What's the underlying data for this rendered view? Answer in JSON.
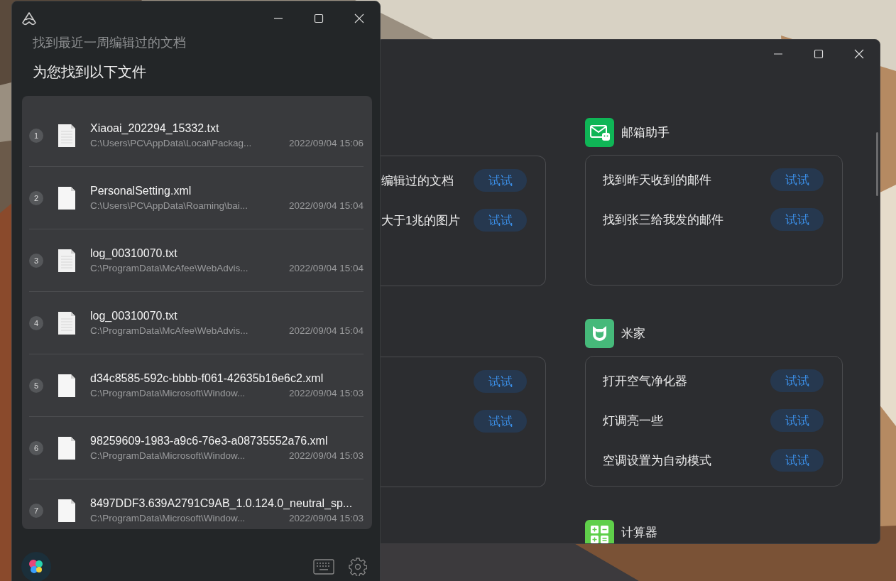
{
  "assistant_window": {
    "query": "找到最近一周编辑过的文档",
    "answer": "为您找到以下文件",
    "files": [
      {
        "number": "1",
        "kind": "text",
        "name": "Xiaoai_202294_15332.txt",
        "path": "C:\\Users\\PC\\AppData\\Local\\Packag...",
        "time": "2022/09/04 15:06"
      },
      {
        "number": "2",
        "kind": "blank",
        "name": "PersonalSetting.xml",
        "path": "C:\\Users\\PC\\AppData\\Roaming\\bai...",
        "time": "2022/09/04 15:04"
      },
      {
        "number": "3",
        "kind": "text",
        "name": "log_00310070.txt",
        "path": "C:\\ProgramData\\McAfee\\WebAdvis...",
        "time": "2022/09/04 15:04"
      },
      {
        "number": "4",
        "kind": "text",
        "name": "log_00310070.txt",
        "path": "C:\\ProgramData\\McAfee\\WebAdvis...",
        "time": "2022/09/04 15:04"
      },
      {
        "number": "5",
        "kind": "blank",
        "name": "d34c8585-592c-bbbb-f061-42635b16e6c2.xml",
        "path": "C:\\ProgramData\\Microsoft\\Window...",
        "time": "2022/09/04 15:03"
      },
      {
        "number": "6",
        "kind": "blank",
        "name": "98259609-1983-a9c6-76e3-a08735552a76.xml",
        "path": "C:\\ProgramData\\Microsoft\\Window...",
        "time": "2022/09/04 15:03"
      },
      {
        "number": "7",
        "kind": "blank",
        "name": "8497DDF3.639A2791C9AB_1.0.124.0_neutral_sp...",
        "path": "C:\\ProgramData\\Microsoft\\Window...",
        "time": "2022/09/04 15:03"
      }
    ]
  },
  "skills_window": {
    "left_cards": [
      {
        "items": [
          {
            "text": "编辑过的文档",
            "button": "试试"
          },
          {
            "text": "大于1兆的图片",
            "button": "试试"
          }
        ]
      },
      {
        "items": [
          {
            "button": "试试"
          },
          {
            "button": "试试"
          }
        ]
      }
    ],
    "sections": [
      {
        "title": "邮箱助手",
        "kind": "mail",
        "items": [
          {
            "text": "找到昨天收到的邮件",
            "button": "试试"
          },
          {
            "text": "找到张三给我发的邮件",
            "button": "试试"
          }
        ]
      },
      {
        "title": "米家",
        "kind": "home",
        "items": [
          {
            "text": "打开空气净化器",
            "button": "试试"
          },
          {
            "text": "灯调亮一些",
            "button": "试试"
          },
          {
            "text": "空调设置为自动模式",
            "button": "试试"
          }
        ]
      },
      {
        "title": "计算器",
        "kind": "calculator"
      }
    ]
  }
}
